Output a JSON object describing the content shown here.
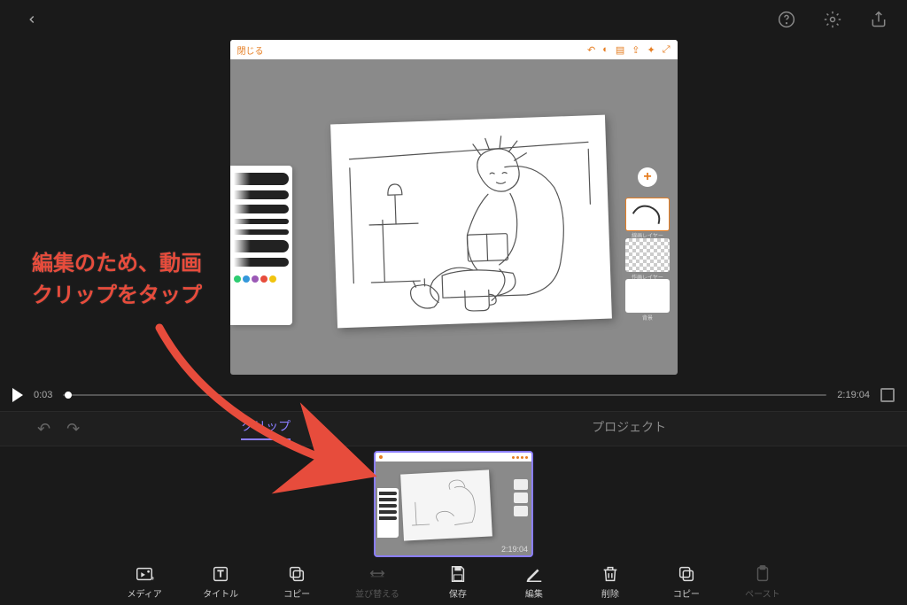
{
  "topbar": {},
  "doc": {
    "close_label": "閉じる",
    "layer1_label": "線画レイヤー",
    "layer2_label": "作画レイヤー",
    "layer3_label": "背景"
  },
  "playback": {
    "current_time": "0:03",
    "total_time": "2:19:04"
  },
  "tabs": {
    "clip": "クリップ",
    "project": "プロジェクト"
  },
  "clip": {
    "duration": "2:19:04"
  },
  "tools": {
    "media": "メディア",
    "title": "タイトル",
    "copy": "コピー",
    "reorder": "並び替える",
    "save": "保存",
    "edit": "編集",
    "delete": "削除",
    "copy2": "コピー",
    "paste": "ペースト"
  },
  "annotation": {
    "line1": "編集のため、動画",
    "line2": "クリップをタップ"
  }
}
